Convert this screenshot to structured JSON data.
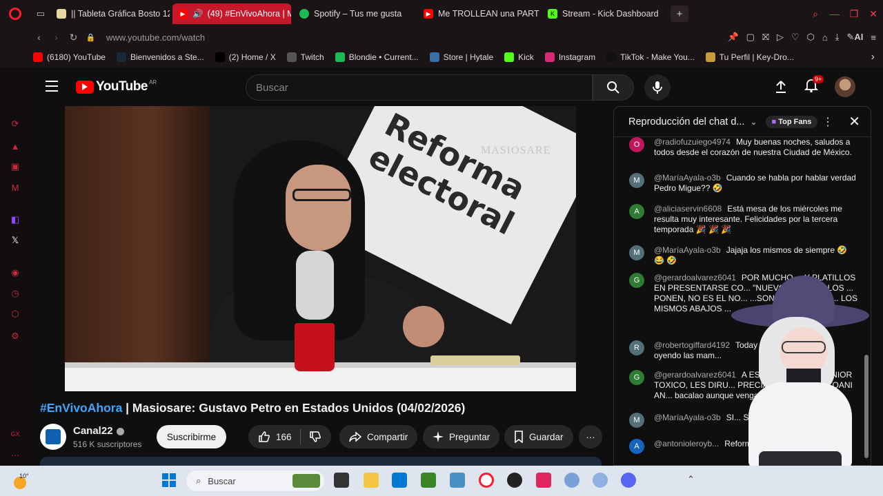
{
  "browser": {
    "tabs": [
      {
        "label": "|| Tableta Gráfica Bosto 12",
        "active": false,
        "color": "#e9d7a0"
      },
      {
        "label": "(49) #EnVivoAhora | M",
        "active": true,
        "color": "#ff0000"
      },
      {
        "label": "Spotify – Tus me gusta",
        "active": false,
        "color": "#1db954"
      },
      {
        "label": "Me TROLLEAN una PARTI",
        "active": false,
        "color": "#ff0000"
      },
      {
        "label": "Stream - Kick Dashboard",
        "active": false,
        "color": "#53fc18"
      }
    ],
    "url": "www.youtube.com/watch",
    "ai_label": "AI",
    "bookmarks": [
      {
        "label": "(6180) YouTube",
        "icon": "youtube-icon",
        "color": "#ff0000"
      },
      {
        "label": "Bienvenidos a Ste...",
        "icon": "steam-icon",
        "color": "#1b2838"
      },
      {
        "label": "(2) Home / X",
        "icon": "x-icon",
        "color": "#000000"
      },
      {
        "label": "Twitch",
        "icon": "document-icon",
        "color": "#555555"
      },
      {
        "label": "Blondie • Current...",
        "icon": "spotify-icon",
        "color": "#1db954"
      },
      {
        "label": "Store | Hytale",
        "icon": "hytale-icon",
        "color": "#3a6ea5"
      },
      {
        "label": "Kick",
        "icon": "kick-icon",
        "color": "#53fc18"
      },
      {
        "label": "Instagram",
        "icon": "instagram-icon",
        "color": "#d62976"
      },
      {
        "label": "TikTok - Make You...",
        "icon": "tiktok-icon",
        "color": "#111111"
      },
      {
        "label": "Tu Perfil | Key-Dro...",
        "icon": "keydrop-icon",
        "color": "#c49a3a"
      }
    ]
  },
  "youtube": {
    "logo_text": "YouTube",
    "region": "AR",
    "search_placeholder": "Buscar",
    "notification_count": "9+",
    "video": {
      "sign_text": "Reforma electoral",
      "watermark": "MASIOSARE",
      "title_tag": "#EnVivoAhora",
      "title_rest": " | Masiosare: Gustavo Petro en Estados Unidos (04/02/2026)"
    },
    "channel": {
      "name": "Canal22",
      "subscribers": "516 K suscriptores",
      "subscribe_label": "Suscribirme"
    },
    "actions": {
      "likes": "166",
      "share": "Compartir",
      "ask": "Preguntar",
      "save": "Guardar"
    },
    "chat": {
      "title": "Reproducción del chat d...",
      "top_fans": "Top Fans",
      "messages": [
        {
          "initial": "O",
          "color": "#c2185b",
          "user": "@radiofuzuiego4974",
          "text": "Muy buenas noches, saludos a todos desde el corazón de nuestra Ciudad de México."
        },
        {
          "initial": "M",
          "color": "#546e7a",
          "user": "@MaríaAyala-o3b",
          "text": "Cuando se habla por hablar verdad Pedro Migue?? 🤣"
        },
        {
          "initial": "A",
          "color": "#2e7d32",
          "user": "@aliciaservin6608",
          "text": "Está mesa de los miércoles me resulta muy interesante. Felicidades por la tercera temporada 🎉 🎉 🎉"
        },
        {
          "initial": "M",
          "color": "#546e7a",
          "user": "@MaríaAyala-o3b",
          "text": "Jajaja los mismos de siempre 🤣 😂 🤣"
        },
        {
          "initial": "G",
          "color": "#2e7d32",
          "user": "@gerardoalvarez6041",
          "text": "POR MUCHO ... Y PLATILLOS EN PRESENTARSE CO... \"NUEVO\", NO SON LOS ... PONEN, NO ES EL NO... ...SON LOS MISMOS ... LOS MISMOS ABAJOS ..."
        },
        {
          "initial": "R",
          "color": "#546e7a",
          "user": "@robertogiffard4192",
          "text": "Today ... vaca, y ya están oyendo las mam..."
        },
        {
          "initial": "G",
          "color": "#2e7d32",
          "user": "@gerardoalvarez6041",
          "text": "A ESE ... RUPO DEL JUNIOR TOXICO, LES DIRU... PRECIA NUESTRO TLATOANI AN... bacalao aunque venga..."
        },
        {
          "initial": "M",
          "color": "#546e7a",
          "user": "@MaríaAyala-o3b",
          "text": "SI... SÓLO Q NO TIENEN..."
        },
        {
          "initial": "A",
          "color": "#1565c0",
          "user": "@antonioleroyb...",
          "text": "Reforma pero ya..."
        }
      ]
    }
  },
  "taskbar": {
    "weather_temp": "10°",
    "search_placeholder": "Buscar"
  }
}
